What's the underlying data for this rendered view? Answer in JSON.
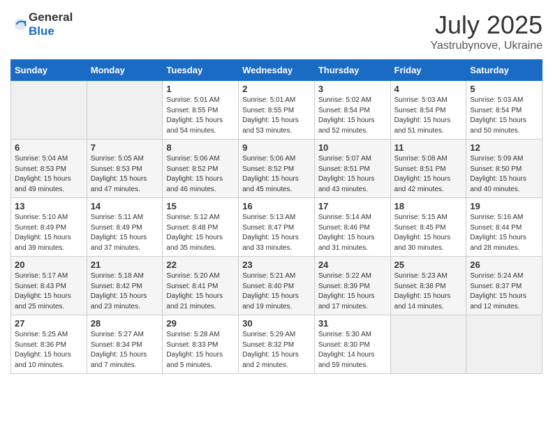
{
  "header": {
    "logo_general": "General",
    "logo_blue": "Blue",
    "title": "July 2025",
    "subtitle": "Yastrubynove, Ukraine"
  },
  "weekdays": [
    "Sunday",
    "Monday",
    "Tuesday",
    "Wednesday",
    "Thursday",
    "Friday",
    "Saturday"
  ],
  "weeks": [
    [
      {
        "day": "",
        "sunrise": "",
        "sunset": "",
        "daylight": "",
        "empty": true
      },
      {
        "day": "",
        "sunrise": "",
        "sunset": "",
        "daylight": "",
        "empty": true
      },
      {
        "day": "1",
        "sunrise": "Sunrise: 5:01 AM",
        "sunset": "Sunset: 8:55 PM",
        "daylight": "Daylight: 15 hours and 54 minutes.",
        "empty": false
      },
      {
        "day": "2",
        "sunrise": "Sunrise: 5:01 AM",
        "sunset": "Sunset: 8:55 PM",
        "daylight": "Daylight: 15 hours and 53 minutes.",
        "empty": false
      },
      {
        "day": "3",
        "sunrise": "Sunrise: 5:02 AM",
        "sunset": "Sunset: 8:54 PM",
        "daylight": "Daylight: 15 hours and 52 minutes.",
        "empty": false
      },
      {
        "day": "4",
        "sunrise": "Sunrise: 5:03 AM",
        "sunset": "Sunset: 8:54 PM",
        "daylight": "Daylight: 15 hours and 51 minutes.",
        "empty": false
      },
      {
        "day": "5",
        "sunrise": "Sunrise: 5:03 AM",
        "sunset": "Sunset: 8:54 PM",
        "daylight": "Daylight: 15 hours and 50 minutes.",
        "empty": false
      }
    ],
    [
      {
        "day": "6",
        "sunrise": "Sunrise: 5:04 AM",
        "sunset": "Sunset: 8:53 PM",
        "daylight": "Daylight: 15 hours and 49 minutes.",
        "empty": false
      },
      {
        "day": "7",
        "sunrise": "Sunrise: 5:05 AM",
        "sunset": "Sunset: 8:53 PM",
        "daylight": "Daylight: 15 hours and 47 minutes.",
        "empty": false
      },
      {
        "day": "8",
        "sunrise": "Sunrise: 5:06 AM",
        "sunset": "Sunset: 8:52 PM",
        "daylight": "Daylight: 15 hours and 46 minutes.",
        "empty": false
      },
      {
        "day": "9",
        "sunrise": "Sunrise: 5:06 AM",
        "sunset": "Sunset: 8:52 PM",
        "daylight": "Daylight: 15 hours and 45 minutes.",
        "empty": false
      },
      {
        "day": "10",
        "sunrise": "Sunrise: 5:07 AM",
        "sunset": "Sunset: 8:51 PM",
        "daylight": "Daylight: 15 hours and 43 minutes.",
        "empty": false
      },
      {
        "day": "11",
        "sunrise": "Sunrise: 5:08 AM",
        "sunset": "Sunset: 8:51 PM",
        "daylight": "Daylight: 15 hours and 42 minutes.",
        "empty": false
      },
      {
        "day": "12",
        "sunrise": "Sunrise: 5:09 AM",
        "sunset": "Sunset: 8:50 PM",
        "daylight": "Daylight: 15 hours and 40 minutes.",
        "empty": false
      }
    ],
    [
      {
        "day": "13",
        "sunrise": "Sunrise: 5:10 AM",
        "sunset": "Sunset: 8:49 PM",
        "daylight": "Daylight: 15 hours and 39 minutes.",
        "empty": false
      },
      {
        "day": "14",
        "sunrise": "Sunrise: 5:11 AM",
        "sunset": "Sunset: 8:49 PM",
        "daylight": "Daylight: 15 hours and 37 minutes.",
        "empty": false
      },
      {
        "day": "15",
        "sunrise": "Sunrise: 5:12 AM",
        "sunset": "Sunset: 8:48 PM",
        "daylight": "Daylight: 15 hours and 35 minutes.",
        "empty": false
      },
      {
        "day": "16",
        "sunrise": "Sunrise: 5:13 AM",
        "sunset": "Sunset: 8:47 PM",
        "daylight": "Daylight: 15 hours and 33 minutes.",
        "empty": false
      },
      {
        "day": "17",
        "sunrise": "Sunrise: 5:14 AM",
        "sunset": "Sunset: 8:46 PM",
        "daylight": "Daylight: 15 hours and 31 minutes.",
        "empty": false
      },
      {
        "day": "18",
        "sunrise": "Sunrise: 5:15 AM",
        "sunset": "Sunset: 8:45 PM",
        "daylight": "Daylight: 15 hours and 30 minutes.",
        "empty": false
      },
      {
        "day": "19",
        "sunrise": "Sunrise: 5:16 AM",
        "sunset": "Sunset: 8:44 PM",
        "daylight": "Daylight: 15 hours and 28 minutes.",
        "empty": false
      }
    ],
    [
      {
        "day": "20",
        "sunrise": "Sunrise: 5:17 AM",
        "sunset": "Sunset: 8:43 PM",
        "daylight": "Daylight: 15 hours and 25 minutes.",
        "empty": false
      },
      {
        "day": "21",
        "sunrise": "Sunrise: 5:18 AM",
        "sunset": "Sunset: 8:42 PM",
        "daylight": "Daylight: 15 hours and 23 minutes.",
        "empty": false
      },
      {
        "day": "22",
        "sunrise": "Sunrise: 5:20 AM",
        "sunset": "Sunset: 8:41 PM",
        "daylight": "Daylight: 15 hours and 21 minutes.",
        "empty": false
      },
      {
        "day": "23",
        "sunrise": "Sunrise: 5:21 AM",
        "sunset": "Sunset: 8:40 PM",
        "daylight": "Daylight: 15 hours and 19 minutes.",
        "empty": false
      },
      {
        "day": "24",
        "sunrise": "Sunrise: 5:22 AM",
        "sunset": "Sunset: 8:39 PM",
        "daylight": "Daylight: 15 hours and 17 minutes.",
        "empty": false
      },
      {
        "day": "25",
        "sunrise": "Sunrise: 5:23 AM",
        "sunset": "Sunset: 8:38 PM",
        "daylight": "Daylight: 15 hours and 14 minutes.",
        "empty": false
      },
      {
        "day": "26",
        "sunrise": "Sunrise: 5:24 AM",
        "sunset": "Sunset: 8:37 PM",
        "daylight": "Daylight: 15 hours and 12 minutes.",
        "empty": false
      }
    ],
    [
      {
        "day": "27",
        "sunrise": "Sunrise: 5:25 AM",
        "sunset": "Sunset: 8:36 PM",
        "daylight": "Daylight: 15 hours and 10 minutes.",
        "empty": false
      },
      {
        "day": "28",
        "sunrise": "Sunrise: 5:27 AM",
        "sunset": "Sunset: 8:34 PM",
        "daylight": "Daylight: 15 hours and 7 minutes.",
        "empty": false
      },
      {
        "day": "29",
        "sunrise": "Sunrise: 5:28 AM",
        "sunset": "Sunset: 8:33 PM",
        "daylight": "Daylight: 15 hours and 5 minutes.",
        "empty": false
      },
      {
        "day": "30",
        "sunrise": "Sunrise: 5:29 AM",
        "sunset": "Sunset: 8:32 PM",
        "daylight": "Daylight: 15 hours and 2 minutes.",
        "empty": false
      },
      {
        "day": "31",
        "sunrise": "Sunrise: 5:30 AM",
        "sunset": "Sunset: 8:30 PM",
        "daylight": "Daylight: 14 hours and 59 minutes.",
        "empty": false
      },
      {
        "day": "",
        "sunrise": "",
        "sunset": "",
        "daylight": "",
        "empty": true
      },
      {
        "day": "",
        "sunrise": "",
        "sunset": "",
        "daylight": "",
        "empty": true
      }
    ]
  ]
}
